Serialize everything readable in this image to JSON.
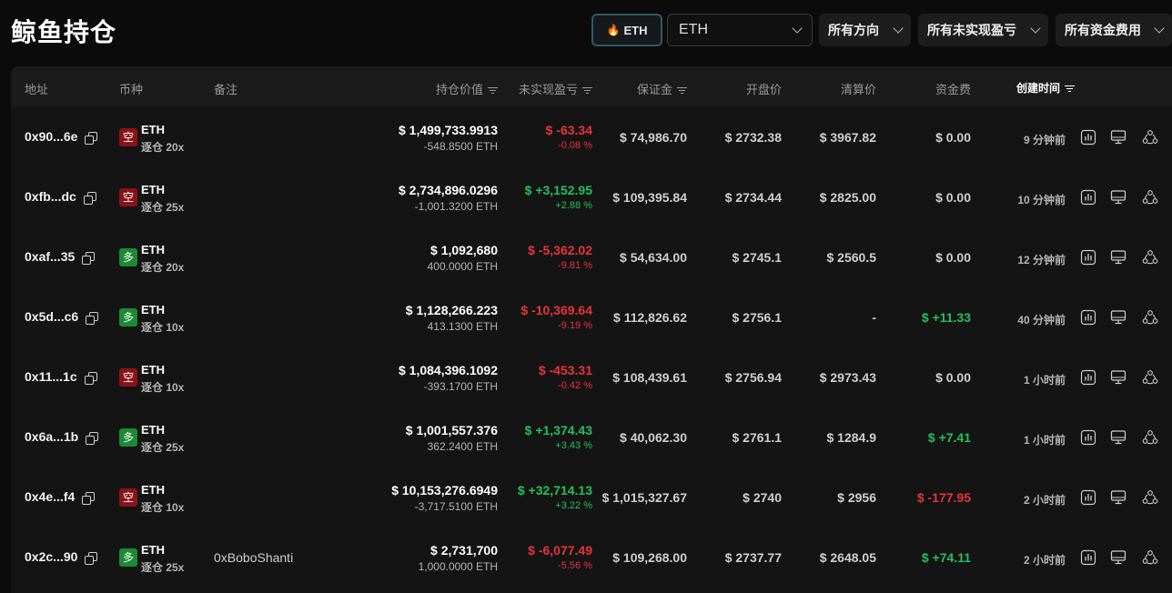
{
  "page": {
    "title": "鲸鱼持仓"
  },
  "toolbar": {
    "eth_button": "ETH",
    "fire_icon": "🔥",
    "symbol_select": "ETH",
    "direction": "所有方向",
    "unrealized": "所有未实现盈亏",
    "funding": "所有资金费用"
  },
  "colors": {
    "short": "#8b1218",
    "long": "#1a8a34",
    "negative": "#e8333a",
    "positive": "#23c05c",
    "accent_border": "#2f5a66"
  },
  "table": {
    "headers": {
      "address": "地址",
      "coin": "币种",
      "note": "备注",
      "position_value": "持仓价值",
      "unrealized_pnl": "未实现盈亏",
      "margin": "保证金",
      "open_price": "开盘价",
      "liq_price": "清算价",
      "funding_fee": "资金费",
      "created": "创建时间"
    },
    "rows": [
      {
        "address": "0x90...6e",
        "side": "空",
        "side_type": "short",
        "coin": "ETH",
        "leverage": "逐仓 20x",
        "note": "",
        "value": "$ 1,499,733.9913",
        "size": "-548.8500 ETH",
        "pnl": "$ -63.34",
        "pnl_pct": "-0.08 %",
        "pnl_sign": "neg",
        "margin": "$ 74,986.70",
        "open": "$ 2732.38",
        "liq": "$ 3967.82",
        "fee": "$ 0.00",
        "fee_sign": "neu",
        "time": "9 分钟前"
      },
      {
        "address": "0xfb...dc",
        "side": "空",
        "side_type": "short",
        "coin": "ETH",
        "leverage": "逐仓 25x",
        "note": "",
        "value": "$ 2,734,896.0296",
        "size": "-1,001.3200 ETH",
        "pnl": "$ +3,152.95",
        "pnl_pct": "+2.88 %",
        "pnl_sign": "pos",
        "margin": "$ 109,395.84",
        "open": "$ 2734.44",
        "liq": "$ 2825.00",
        "fee": "$ 0.00",
        "fee_sign": "neu",
        "time": "10 分钟前"
      },
      {
        "address": "0xaf...35",
        "side": "多",
        "side_type": "long",
        "coin": "ETH",
        "leverage": "逐仓 20x",
        "note": "",
        "value": "$ 1,092,680",
        "size": "400.0000 ETH",
        "pnl": "$ -5,362.02",
        "pnl_pct": "-9.81 %",
        "pnl_sign": "neg",
        "margin": "$ 54,634.00",
        "open": "$ 2745.1",
        "liq": "$ 2560.5",
        "fee": "$ 0.00",
        "fee_sign": "neu",
        "time": "12 分钟前"
      },
      {
        "address": "0x5d...c6",
        "side": "多",
        "side_type": "long",
        "coin": "ETH",
        "leverage": "逐仓 10x",
        "note": "",
        "value": "$ 1,128,266.223",
        "size": "413.1300 ETH",
        "pnl": "$ -10,369.64",
        "pnl_pct": "-9.19 %",
        "pnl_sign": "neg",
        "margin": "$ 112,826.62",
        "open": "$ 2756.1",
        "liq": "-",
        "fee": "$ +11.33",
        "fee_sign": "pos",
        "time": "40 分钟前"
      },
      {
        "address": "0x11...1c",
        "side": "空",
        "side_type": "short",
        "coin": "ETH",
        "leverage": "逐仓 10x",
        "note": "",
        "value": "$ 1,084,396.1092",
        "size": "-393.1700 ETH",
        "pnl": "$ -453.31",
        "pnl_pct": "-0.42 %",
        "pnl_sign": "neg",
        "margin": "$ 108,439.61",
        "open": "$ 2756.94",
        "liq": "$ 2973.43",
        "fee": "$ 0.00",
        "fee_sign": "neu",
        "time": "1 小时前"
      },
      {
        "address": "0x6a...1b",
        "side": "多",
        "side_type": "long",
        "coin": "ETH",
        "leverage": "逐仓 25x",
        "note": "",
        "value": "$ 1,001,557.376",
        "size": "362.2400 ETH",
        "pnl": "$ +1,374.43",
        "pnl_pct": "+3.43 %",
        "pnl_sign": "pos",
        "margin": "$ 40,062.30",
        "open": "$ 2761.1",
        "liq": "$ 1284.9",
        "fee": "$ +7.41",
        "fee_sign": "pos",
        "time": "1 小时前"
      },
      {
        "address": "0x4e...f4",
        "side": "空",
        "side_type": "short",
        "coin": "ETH",
        "leverage": "逐仓 10x",
        "note": "",
        "value": "$ 10,153,276.6949",
        "size": "-3,717.5100 ETH",
        "pnl": "$ +32,714.13",
        "pnl_pct": "+3.22 %",
        "pnl_sign": "pos",
        "margin": "$ 1,015,327.67",
        "open": "$ 2740",
        "liq": "$ 2956",
        "fee": "$ -177.95",
        "fee_sign": "neg",
        "time": "2 小时前"
      },
      {
        "address": "0x2c...90",
        "side": "多",
        "side_type": "long",
        "coin": "ETH",
        "leverage": "逐仓 25x",
        "note": "0xBoboShanti",
        "value": "$ 2,731,700",
        "size": "1,000.0000 ETH",
        "pnl": "$ -6,077.49",
        "pnl_pct": "-5.56 %",
        "pnl_sign": "neg",
        "margin": "$ 109,268.00",
        "open": "$ 2737.77",
        "liq": "$ 2648.05",
        "fee": "$ +74.11",
        "fee_sign": "pos",
        "time": "2 小时前"
      }
    ]
  }
}
